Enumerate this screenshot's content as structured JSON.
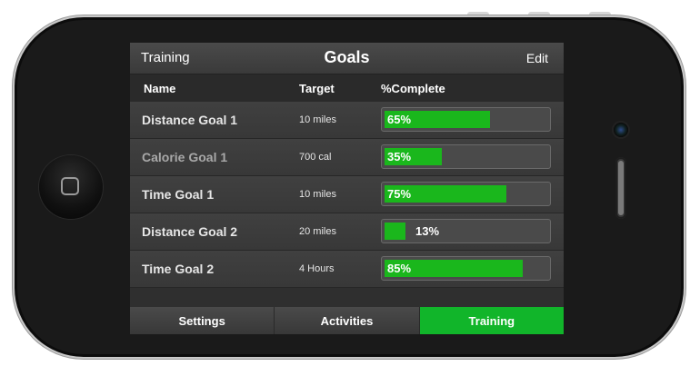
{
  "nav": {
    "back_label": "Training",
    "title": "Goals",
    "edit_label": "Edit"
  },
  "columns": {
    "name": "Name",
    "target": "Target",
    "complete": "%Complete"
  },
  "goals": [
    {
      "name": "Distance Goal 1",
      "target": "10 miles",
      "percent": 65,
      "percent_label": "65%",
      "dim": false
    },
    {
      "name": "Calorie Goal 1",
      "target": "700 cal",
      "percent": 35,
      "percent_label": "35%",
      "dim": true
    },
    {
      "name": "Time Goal 1",
      "target": "10 miles",
      "percent": 75,
      "percent_label": "75%",
      "dim": false
    },
    {
      "name": "Distance Goal 2",
      "target": "20 miles",
      "percent": 13,
      "percent_label": "13%",
      "dim": false
    },
    {
      "name": "Time Goal 2",
      "target": "4 Hours",
      "percent": 85,
      "percent_label": "85%",
      "dim": false
    }
  ],
  "tabs": [
    {
      "label": "Settings",
      "active": false
    },
    {
      "label": "Activities",
      "active": false
    },
    {
      "label": "Training",
      "active": true
    }
  ],
  "colors": {
    "accent_green": "#11b52a",
    "progress_green": "#1ab71c",
    "screen_bg": "#2f2f2f"
  }
}
